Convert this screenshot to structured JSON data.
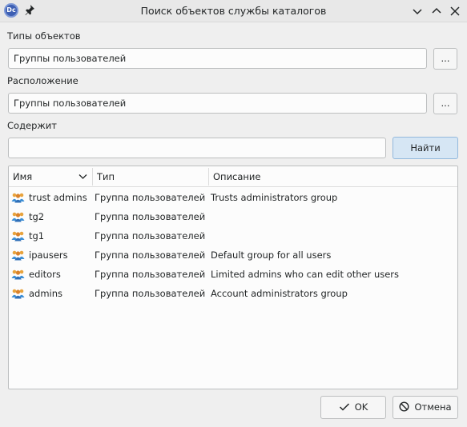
{
  "window": {
    "title": "Поиск объектов службы каталогов",
    "app_icon_text": "Dc"
  },
  "object_types": {
    "label": "Типы объектов",
    "value": "Группы пользователей",
    "browse_label": "..."
  },
  "location": {
    "label": "Расположение",
    "value": "Группы пользователей",
    "browse_label": "..."
  },
  "contains": {
    "label": "Содержит",
    "value": "",
    "find_label": "Найти"
  },
  "table": {
    "columns": [
      "Имя",
      "Тип",
      "Описание"
    ],
    "rows": [
      {
        "name": "trust admins",
        "type": "Группа пользователей",
        "description": "Trusts administrators group"
      },
      {
        "name": "tg2",
        "type": "Группа пользователей",
        "description": ""
      },
      {
        "name": "tg1",
        "type": "Группа пользователей",
        "description": ""
      },
      {
        "name": "ipausers",
        "type": "Группа пользователей",
        "description": "Default group for all users"
      },
      {
        "name": "editors",
        "type": "Группа пользователей",
        "description": "Limited admins who can edit other users"
      },
      {
        "name": "admins",
        "type": "Группа пользователей",
        "description": "Account administrators group"
      }
    ]
  },
  "buttons": {
    "ok_label": "OK",
    "cancel_label": "Отмена"
  },
  "icons": {
    "row_icon": "user-group-icon",
    "app": "app-logo-icon",
    "pin": "pin-icon",
    "minimize": "chevron-down-icon",
    "maximize": "chevron-up-icon",
    "close": "close-icon"
  },
  "colors": {
    "accent": "#3daee9",
    "find_button_bg": "#d6e6f4",
    "background": "#efefef"
  }
}
